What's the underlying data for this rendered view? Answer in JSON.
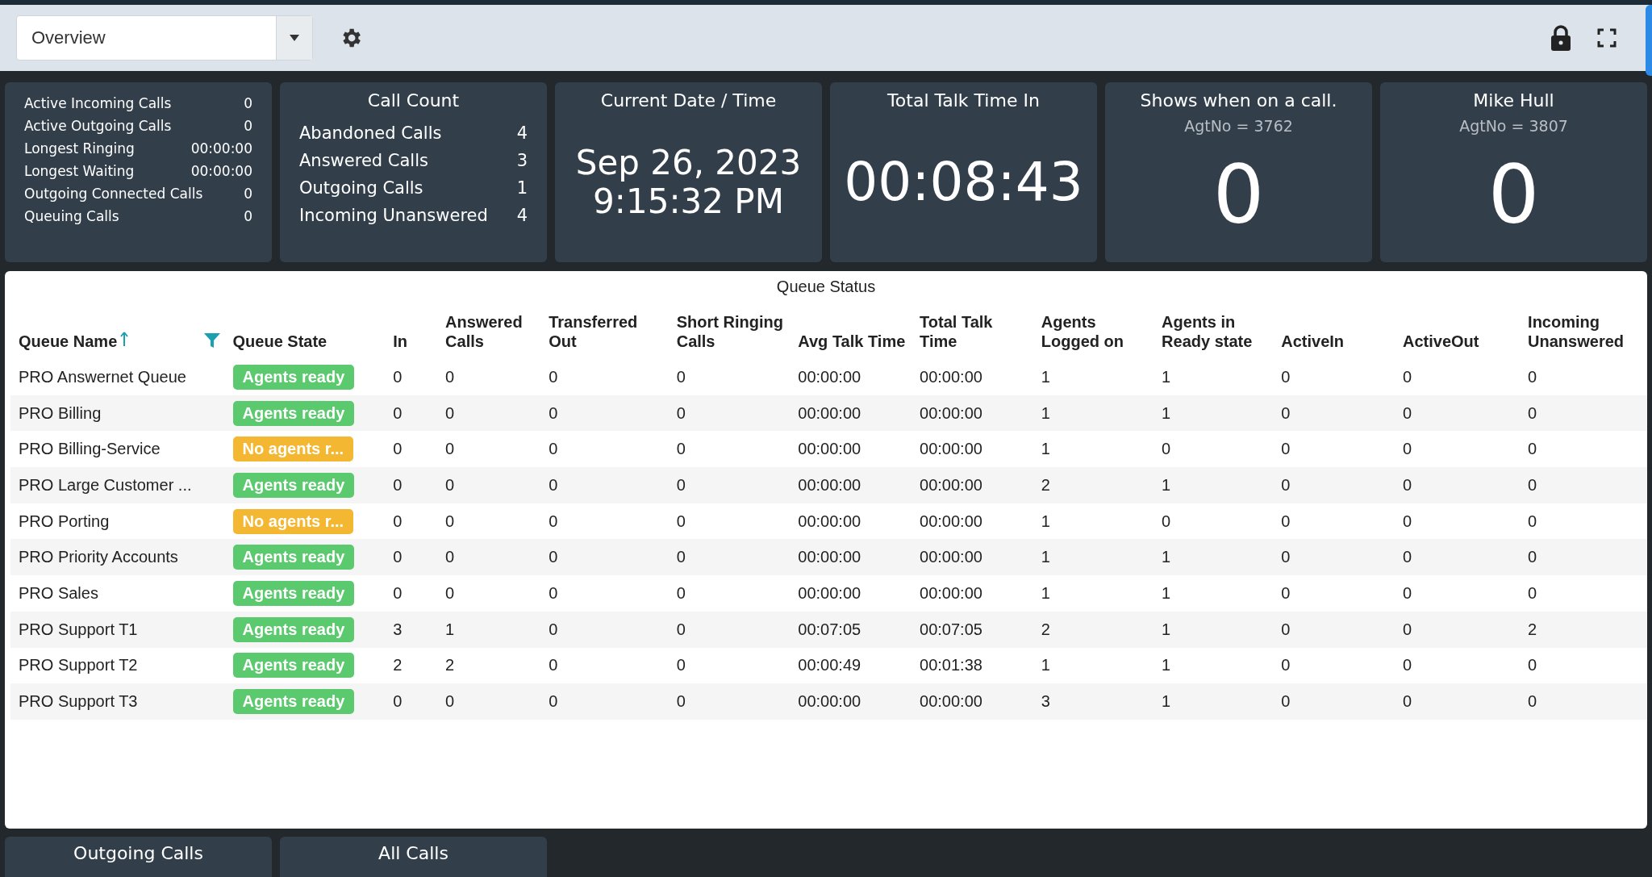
{
  "toolbar": {
    "view_select": {
      "value": "Overview"
    }
  },
  "summary_stats": [
    {
      "label": "Active Incoming Calls",
      "value": "0"
    },
    {
      "label": "Active Outgoing Calls",
      "value": "0"
    },
    {
      "label": "Longest Ringing",
      "value": "00:00:00"
    },
    {
      "label": "Longest Waiting",
      "value": "00:00:00"
    },
    {
      "label": "Outgoing Connected Calls",
      "value": "0"
    },
    {
      "label": "Queuing Calls",
      "value": "0"
    }
  ],
  "call_count": {
    "title": "Call Count",
    "items": [
      {
        "label": "Abandoned Calls",
        "value": "4"
      },
      {
        "label": "Answered Calls",
        "value": "3"
      },
      {
        "label": "Outgoing Calls",
        "value": "1"
      },
      {
        "label": "Incoming Unanswered",
        "value": "4"
      }
    ]
  },
  "datetime_card": {
    "title": "Current Date / Time",
    "date": "Sep 26, 2023",
    "time": "9:15:32 PM"
  },
  "talk_time_card": {
    "title": "Total Talk Time In",
    "value": "00:08:43"
  },
  "agent_cards": [
    {
      "title": "Shows when on a call.",
      "subtitle": "AgtNo = 3762",
      "value": "0"
    },
    {
      "title": "Mike Hull",
      "subtitle": "AgtNo = 3807",
      "value": "0"
    }
  ],
  "queue_status": {
    "title": "Queue Status",
    "columns": [
      {
        "label": "Queue Name",
        "sorted": true,
        "filter": true
      },
      {
        "label": "Queue State"
      },
      {
        "label": "In"
      },
      {
        "label": "Answered Calls"
      },
      {
        "label": "Transferred Out"
      },
      {
        "label": "Short Ringing Calls"
      },
      {
        "label": "Avg Talk Time"
      },
      {
        "label": "Total Talk Time"
      },
      {
        "label": "Agents Logged on"
      },
      {
        "label": "Agents in Ready state"
      },
      {
        "label": "ActiveIn"
      },
      {
        "label": "ActiveOut"
      },
      {
        "label": "Incoming Unanswered"
      }
    ],
    "rows": [
      {
        "cells": [
          "PRO Answernet Queue",
          "Agents ready",
          "0",
          "0",
          "0",
          "0",
          "00:00:00",
          "00:00:00",
          "1",
          "1",
          "0",
          "0",
          "0"
        ],
        "kind": "ready"
      },
      {
        "cells": [
          "PRO Billing",
          "Agents ready",
          "0",
          "0",
          "0",
          "0",
          "00:00:00",
          "00:00:00",
          "1",
          "1",
          "0",
          "0",
          "0"
        ],
        "kind": "ready"
      },
      {
        "cells": [
          "PRO Billing-Service",
          "No agents r...",
          "0",
          "0",
          "0",
          "0",
          "00:00:00",
          "00:00:00",
          "1",
          "0",
          "0",
          "0",
          "0"
        ],
        "kind": "not_ready"
      },
      {
        "cells": [
          "PRO Large Customer ...",
          "Agents ready",
          "0",
          "0",
          "0",
          "0",
          "00:00:00",
          "00:00:00",
          "2",
          "1",
          "0",
          "0",
          "0"
        ],
        "kind": "ready"
      },
      {
        "cells": [
          "PRO Porting",
          "No agents r...",
          "0",
          "0",
          "0",
          "0",
          "00:00:00",
          "00:00:00",
          "1",
          "0",
          "0",
          "0",
          "0"
        ],
        "kind": "not_ready"
      },
      {
        "cells": [
          "PRO Priority Accounts",
          "Agents ready",
          "0",
          "0",
          "0",
          "0",
          "00:00:00",
          "00:00:00",
          "1",
          "1",
          "0",
          "0",
          "0"
        ],
        "kind": "ready"
      },
      {
        "cells": [
          "PRO Sales",
          "Agents ready",
          "0",
          "0",
          "0",
          "0",
          "00:00:00",
          "00:00:00",
          "1",
          "1",
          "0",
          "0",
          "0"
        ],
        "kind": "ready"
      },
      {
        "cells": [
          "PRO Support T1",
          "Agents ready",
          "3",
          "1",
          "0",
          "0",
          "00:07:05",
          "00:07:05",
          "2",
          "1",
          "0",
          "0",
          "2"
        ],
        "kind": "ready"
      },
      {
        "cells": [
          "PRO Support T2",
          "Agents ready",
          "2",
          "2",
          "0",
          "0",
          "00:00:49",
          "00:01:38",
          "1",
          "1",
          "0",
          "0",
          "0"
        ],
        "kind": "ready"
      },
      {
        "cells": [
          "PRO Support T3",
          "Agents ready",
          "0",
          "0",
          "0",
          "0",
          "00:00:00",
          "00:00:00",
          "3",
          "1",
          "0",
          "0",
          "0"
        ],
        "kind": "ready"
      }
    ]
  },
  "bottom_tabs": [
    {
      "label": "Outgoing Calls"
    },
    {
      "label": "All Calls"
    }
  ]
}
